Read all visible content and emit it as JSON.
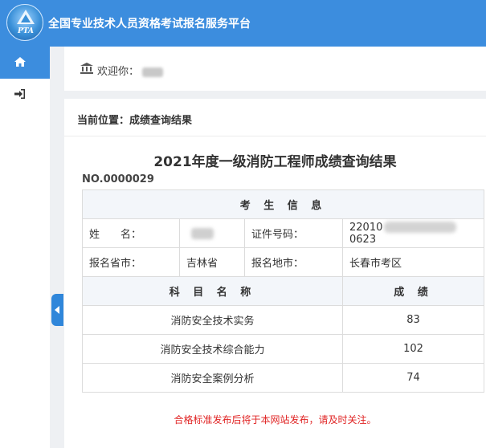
{
  "header": {
    "logo_text": "PTA",
    "title": "全国专业技术人员资格考试报名服务平台"
  },
  "sidebar": {
    "items": [
      {
        "icon": "home-icon",
        "active": true
      },
      {
        "icon": "sign-in-icon",
        "active": false
      }
    ]
  },
  "welcome": {
    "label": "欢迎你："
  },
  "breadcrumb": {
    "text": "当前位置：成绩查询结果"
  },
  "result": {
    "title": "2021年度一级消防工程师成绩查询结果",
    "record_no": "NO.0000029",
    "info_header": "考 生 信 息",
    "fields": {
      "name_label": "姓　　名：",
      "id_label": "证件号码：",
      "id_prefix": "22010",
      "id_suffix": "0623",
      "province_label": "报名省市：",
      "province_value": "吉林省",
      "site_label": "报名地市：",
      "site_value": "长春市考区"
    },
    "scores_header": {
      "subject": "科 目 名 称",
      "score": "成 绩"
    },
    "scores": [
      {
        "subject": "消防安全技术实务",
        "score": "83"
      },
      {
        "subject": "消防安全技术综合能力",
        "score": "102"
      },
      {
        "subject": "消防安全案例分析",
        "score": "74"
      }
    ],
    "notice": "合格标准发布后将于本网站发布，请及时关注。"
  },
  "colors": {
    "header_bg": "#3c8dde",
    "notice": "#e02424"
  }
}
